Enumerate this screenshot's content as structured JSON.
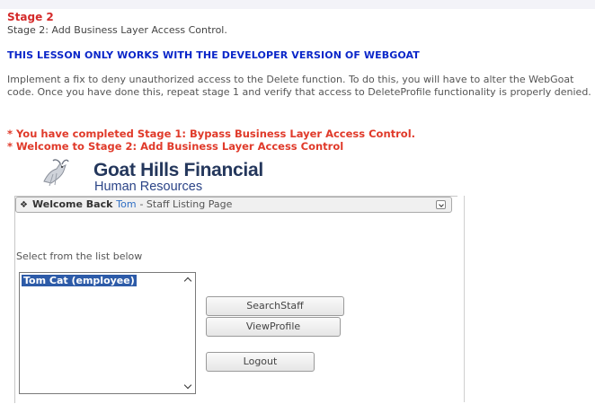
{
  "lesson": {
    "stage_title": "Stage 2",
    "stage_subtitle": "Stage 2: Add Business Layer Access Control.",
    "warning": "THIS LESSON ONLY WORKS WITH THE DEVELOPER VERSION OF WEBGOAT",
    "instructions": "Implement a fix to deny unauthorized access to the Delete function. To do this, you will have to alter the WebGoat code. Once you have done this, repeat stage 1 and verify that access to DeleteProfile functionality is properly denied.",
    "completed_msg": "* You have completed Stage 1: Bypass Business Layer Access Control.",
    "welcome_msg": "* Welcome to Stage 2: Add Business Layer Access Control"
  },
  "app": {
    "logo_title": "Goat Hills Financial",
    "logo_subtitle": "Human Resources",
    "welcome_bar": {
      "prefix": "Welcome Back",
      "user": "Tom",
      "page": "- Staff Listing Page"
    },
    "select_label": "Select from the list below",
    "staff_list": [
      {
        "label": "Tom Cat (employee)",
        "selected": true
      }
    ],
    "buttons": {
      "search_staff": "SearchStaff",
      "view_profile": "ViewProfile",
      "logout": "Logout"
    }
  },
  "colors": {
    "stage_red": "#d42a2a",
    "warning_blue": "#0b27c9",
    "message_red": "#e03a2a",
    "logo_navy": "#24375c",
    "selection_blue": "#2d5ba8",
    "username_blue": "#2f6ec4"
  },
  "icons": [
    "goat-logo-icon",
    "grip-icon",
    "dropdown-icon",
    "scroll-up-icon",
    "scroll-down-icon"
  ]
}
